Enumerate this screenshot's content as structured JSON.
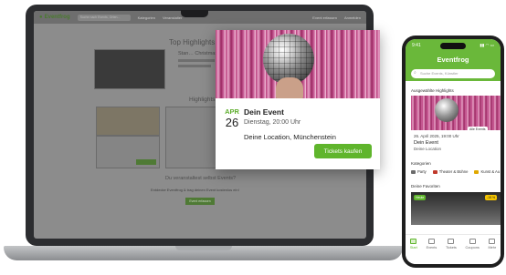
{
  "laptop": {
    "site": {
      "logo": "Eventfrog",
      "search_placeholder": "Suche nach Events, Orten...",
      "nav": [
        "Kategorien",
        "Veranstalter"
      ],
      "nav_right": [
        "Event erfassen",
        "Anmelden"
      ],
      "top_highlights": "Top Highlights",
      "highlight_event_title": "Stan… Christmas Spe…",
      "highlights_heading": "Highlights",
      "bottom_line1": "Du veranstaltest selbst Events?",
      "bottom_line2": "Entdecke Eventfrog & trag deinen Event kostenlos ein!",
      "bottom_button": "Event erfassen"
    },
    "event_card": {
      "month": "APR",
      "day": "26",
      "title": "Dein Event",
      "when": "Dienstag, 20:00 Uhr",
      "location": "Deine Location,  Münchenstein",
      "button": "Tickets kaufen"
    }
  },
  "phone": {
    "time": "9:41",
    "status_icons": "▮▮ ◠ ▭",
    "logo": "Eventfrog",
    "search_placeholder": "Suche Events, Künstler",
    "section_highlights": "Ausgewählte Highlights",
    "more_events": "Alle Events",
    "highlight": {
      "date": "26. April 2025, 19:00 Uhr",
      "title": "Dein Event",
      "location": "Deine Location"
    },
    "section_categories": "Kategorien",
    "categories": [
      "Party",
      "Theater & Bühne",
      "Kunst & Au"
    ],
    "section_favourites": "Deine Favoriten",
    "fav_badge_today": "Heute",
    "fav_badge_discount": "-15 %",
    "tabs": [
      "Start",
      "Events",
      "Tickets",
      "Coupons",
      "Mehr"
    ]
  },
  "colors": {
    "brand_green": "#5fb52c",
    "laptop_frame": "#2c2d30"
  }
}
